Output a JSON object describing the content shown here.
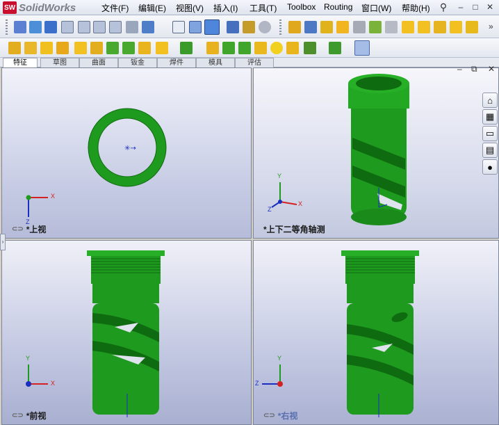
{
  "app": {
    "logo_badge": "SW",
    "name": "SolidWorks"
  },
  "menu": [
    {
      "label": "文件(F)"
    },
    {
      "label": "编辑(E)"
    },
    {
      "label": "视图(V)"
    },
    {
      "label": "插入(I)"
    },
    {
      "label": "工具(T)"
    },
    {
      "label": "Toolbox"
    },
    {
      "label": "Routing"
    },
    {
      "label": "窗口(W)"
    },
    {
      "label": "帮助(H)"
    }
  ],
  "window_controls": {
    "minimize": "–",
    "restore": "□",
    "close": "✕"
  },
  "pane_controls": {
    "minimize": "–",
    "restore": "⧉",
    "close": "✕"
  },
  "tabs": [
    "特征",
    "草图",
    "曲面",
    "钣金",
    "焊件",
    "模具",
    "评估"
  ],
  "viewports": {
    "top": {
      "label": "*上视"
    },
    "iso": {
      "label": "*上下二等角轴测"
    },
    "front": {
      "label": "*前视"
    },
    "right": {
      "label": "*右视"
    }
  },
  "triad": {
    "x": "X",
    "y": "Y",
    "z": "Z"
  },
  "colors": {
    "part_green": "#1e9a1e",
    "part_dark": "#0f6b10",
    "axis_x": "#d42020",
    "axis_y": "#1e9a1e",
    "axis_z": "#1a2fbf"
  }
}
